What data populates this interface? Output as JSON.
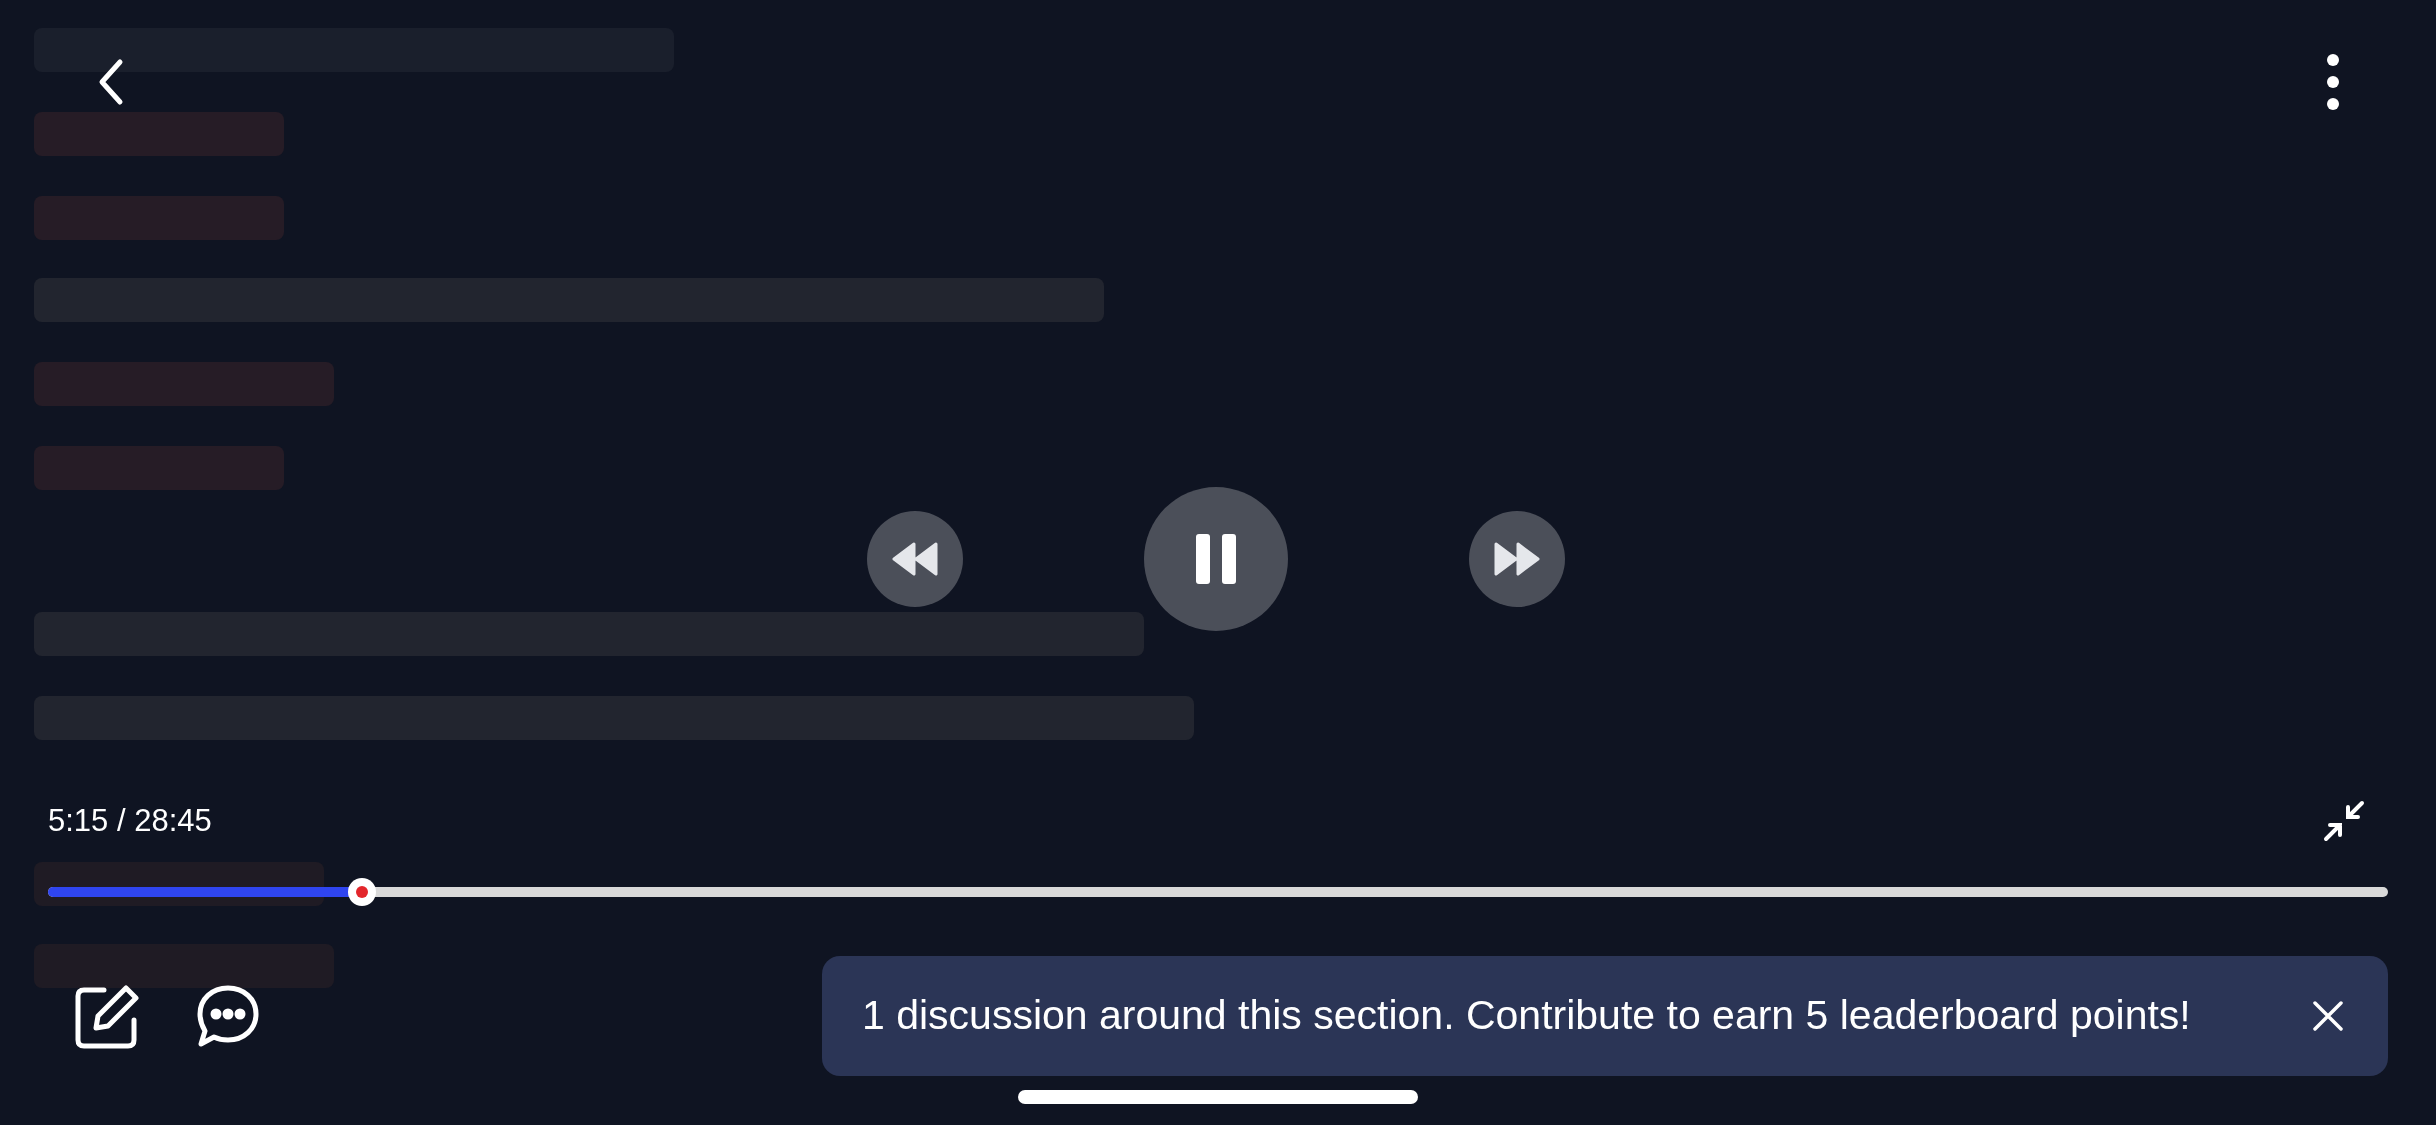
{
  "player": {
    "playing": true,
    "time": "5:15 / 28:45",
    "progress": {
      "level": 0.134
    }
  },
  "toast": {
    "text": "1 discussion around this section. Contribute to earn 5 leaderboard points!"
  }
}
